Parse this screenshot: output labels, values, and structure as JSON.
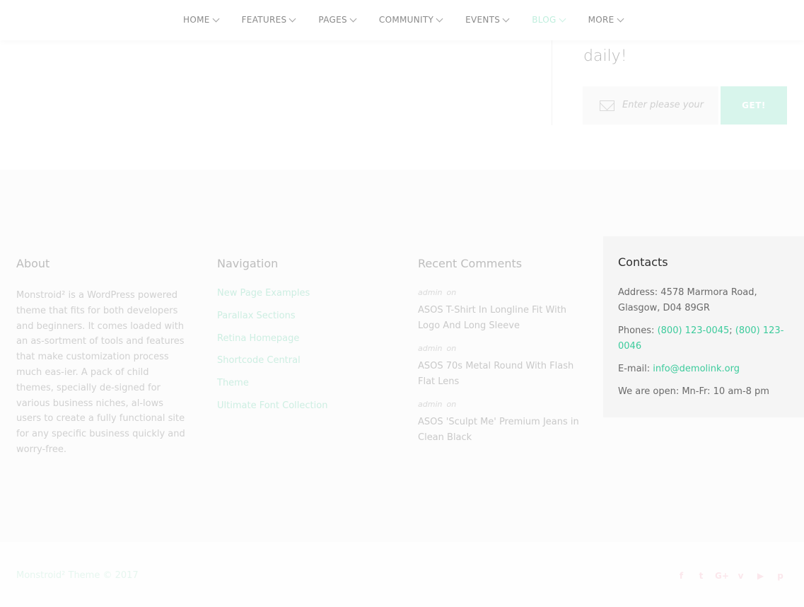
{
  "nav": {
    "items": [
      {
        "label": "HOME"
      },
      {
        "label": "FEATURES"
      },
      {
        "label": "PAGES"
      },
      {
        "label": "COMMUNITY"
      },
      {
        "label": "EVENTS"
      },
      {
        "label": "BLOG",
        "active": true
      },
      {
        "label": "MORE"
      }
    ]
  },
  "subscribe": {
    "heading_tail": "daily!",
    "placeholder": "Enter please your e",
    "button_label": "GET!"
  },
  "footer": {
    "about": {
      "title": "About",
      "text": "Monstroid² is a WordPress powered theme that fits for both developers and beginners. It comes loaded with an as-sortment of tools and features that make customization process much eas-ier. A pack of child themes, specially de-signed for various business niches, al-lows users to create a fully functional site for any specific business quickly and worry-free."
    },
    "navigation": {
      "title": "Navigation",
      "links": [
        "New Page Examples",
        "Parallax Sections",
        "Retina Homepage",
        "Shortcode Central",
        "Theme",
        "Ultimate Font Collection"
      ]
    },
    "recent_comments": {
      "title": "Recent Comments",
      "items": [
        {
          "author": "admin",
          "on": "on",
          "title": "ASOS T-Shirt In Longline Fit With Logo And Long Sleeve"
        },
        {
          "author": "admin",
          "on": "on",
          "title": "ASOS 70s Metal Round With Flash Flat Lens"
        },
        {
          "author": "admin",
          "on": "on",
          "title": "ASOS 'Sculpt Me' Premium Jeans in Clean Black"
        }
      ]
    },
    "contacts": {
      "title": "Contacts",
      "address_label": "Address:",
      "address": "4578 Marmora Road, Glasgow, D04 89GR",
      "phones_label": "Phones:",
      "phone1": "(800) 123-0045",
      "phone_sep": ";",
      "phone2": "(800) 123-0046",
      "email_label": "E-mail:",
      "email": "info@demolink.org",
      "hours": "We are open: Mn-Fr: 10 am-8 pm"
    },
    "copyright": "Monstroid² Theme © 2017",
    "social_icons": [
      "facebook-icon",
      "twitter-icon",
      "google-plus-icon",
      "vimeo-icon",
      "youtube-icon",
      "pinterest-icon"
    ]
  },
  "colors": {
    "accent": "#3ccb9c",
    "accent_light": "#d8f5ec"
  }
}
